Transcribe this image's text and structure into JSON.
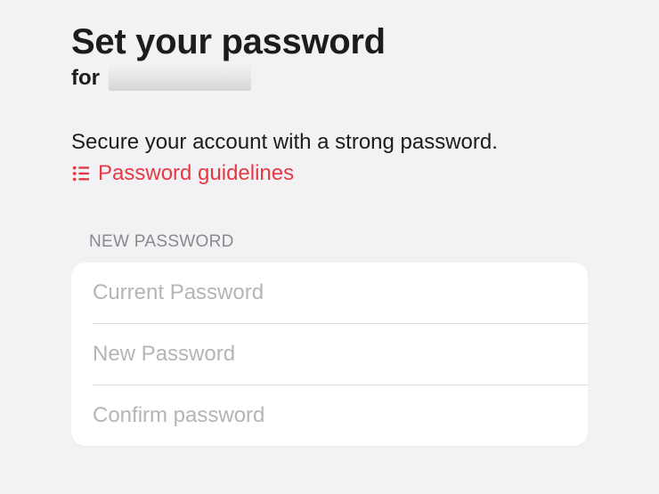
{
  "colors": {
    "background": "#f2f2f4",
    "accent": "#e63946"
  },
  "header": {
    "title": "Set your password",
    "for_label": "for"
  },
  "instructions": {
    "description": "Secure your account with a strong password.",
    "guidelines": "Password guidelines"
  },
  "form": {
    "section_label": "NEW PASSWORD",
    "fields": {
      "current": {
        "placeholder": "Current Password",
        "value": ""
      },
      "new": {
        "placeholder": "New Password",
        "value": ""
      },
      "confirm": {
        "placeholder": "Confirm password",
        "value": ""
      }
    }
  }
}
